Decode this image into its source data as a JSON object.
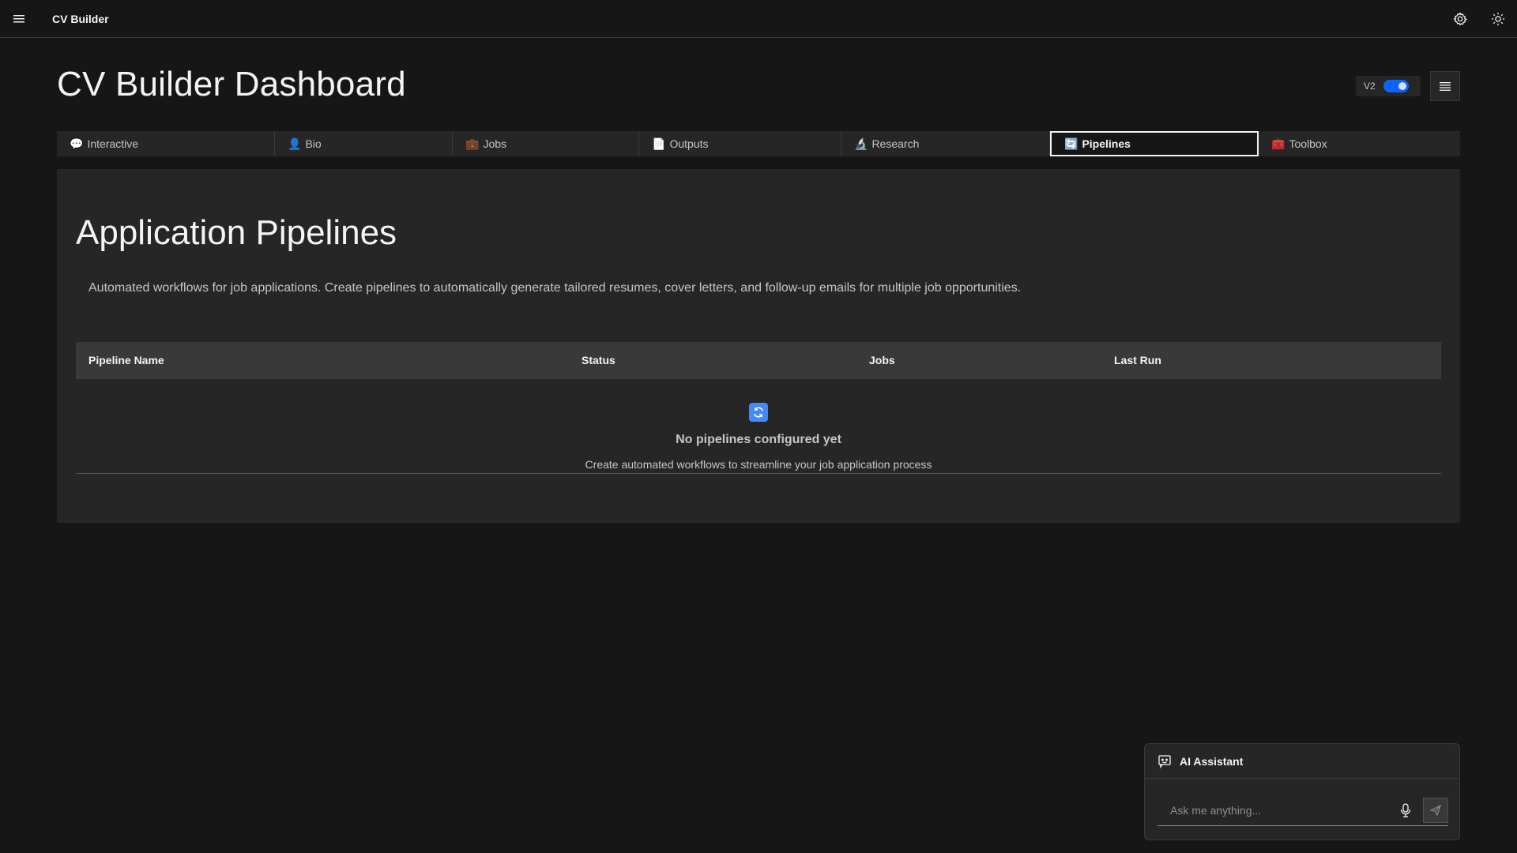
{
  "header": {
    "app_name": "CV Builder",
    "icons": [
      "menu-icon",
      "settings-icon",
      "theme-icon"
    ]
  },
  "page": {
    "title": "CV Builder Dashboard",
    "version_toggle": {
      "label": "V2",
      "on": true,
      "accent": "#0f62fe"
    }
  },
  "tabs": [
    {
      "emoji": "💬",
      "label": "Interactive"
    },
    {
      "emoji": "👤",
      "label": "Bio"
    },
    {
      "emoji": "💼",
      "label": "Jobs"
    },
    {
      "emoji": "📄",
      "label": "Outputs"
    },
    {
      "emoji": "🔬",
      "label": "Research"
    },
    {
      "emoji": "🔄",
      "label": "Pipelines"
    },
    {
      "emoji": "🧰",
      "label": "Toolbox"
    }
  ],
  "active_tab": "Pipelines",
  "pipelines": {
    "title": "Application Pipelines",
    "description": "Automated workflows for job applications. Create pipelines to automatically generate tailored resumes, cover letters, and follow-up emails for multiple job opportunities.",
    "columns": [
      "Pipeline Name",
      "Status",
      "Jobs",
      "Last Run"
    ],
    "empty_state": {
      "icon": "🔄",
      "title": "No pipelines configured yet",
      "subtitle": "Create automated workflows to streamline your job application process"
    }
  },
  "assistant": {
    "title": "AI Assistant",
    "input_placeholder": "Ask me anything..."
  }
}
